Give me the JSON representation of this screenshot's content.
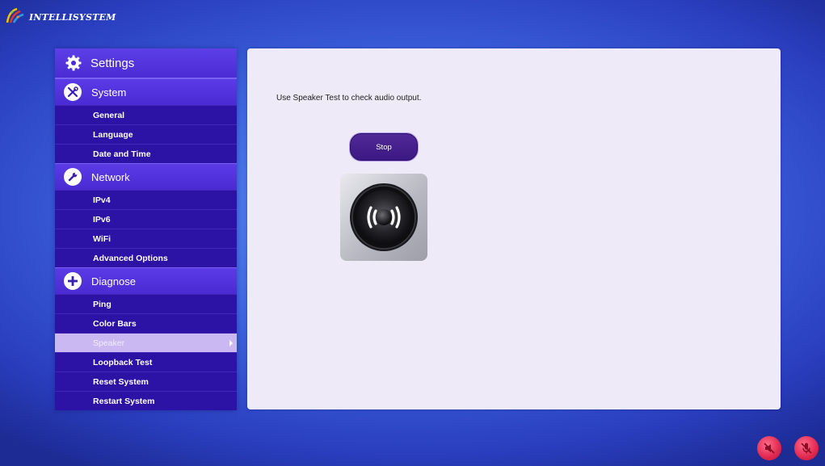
{
  "app": {
    "logo_text": "INTELLISYSTEM"
  },
  "sidebar": {
    "header": {
      "label": "Settings",
      "icon": "gear-icon"
    },
    "sections": [
      {
        "label": "System",
        "icon": "tools-icon",
        "items": [
          {
            "label": "General"
          },
          {
            "label": "Language"
          },
          {
            "label": "Date and Time"
          }
        ]
      },
      {
        "label": "Network",
        "icon": "wrench-icon",
        "items": [
          {
            "label": "IPv4"
          },
          {
            "label": "IPv6"
          },
          {
            "label": "WiFi"
          },
          {
            "label": "Advanced Options"
          }
        ]
      },
      {
        "label": "Diagnose",
        "icon": "plus-icon",
        "items": [
          {
            "label": "Ping"
          },
          {
            "label": "Color Bars"
          },
          {
            "label": "Speaker",
            "active": true
          },
          {
            "label": "Loopback Test"
          },
          {
            "label": "Reset System"
          },
          {
            "label": "Restart System"
          }
        ]
      }
    ]
  },
  "main": {
    "hint": "Use Speaker Test to check audio output.",
    "stop_label": "Stop",
    "speaker_icon": "speaker-icon"
  },
  "status": {
    "speaker_muted_icon": "speaker-muted-icon",
    "mic_muted_icon": "mic-muted-icon"
  },
  "colors": {
    "sidebar_bg": "#3a1fb0",
    "section_bg": "#4a2ad2",
    "active_item": "#c9b8f2",
    "panel_bg": "#efeaf8",
    "button_bg": "#3b1883",
    "alert_red": "#e0284f"
  }
}
